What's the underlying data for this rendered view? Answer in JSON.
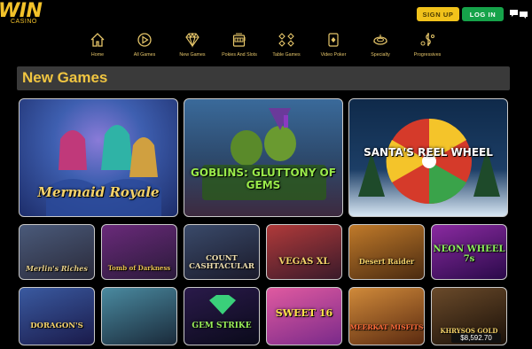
{
  "brand": {
    "name": "WIN",
    "sub": "CASINO"
  },
  "header": {
    "signup_label": "SIGN UP",
    "login_label": "LOG IN",
    "chat_icon": "chat-bubbles-icon"
  },
  "nav": [
    {
      "label": "Home",
      "icon": "home-icon"
    },
    {
      "label": "All Games",
      "icon": "play-circle-icon"
    },
    {
      "label": "New Games",
      "icon": "diamond-icon"
    },
    {
      "label": "Pokies And Slots",
      "icon": "slot-machine-icon"
    },
    {
      "label": "Table Games",
      "icon": "card-suits-icon"
    },
    {
      "label": "Video Poker",
      "icon": "playing-card-icon"
    },
    {
      "label": "Specialty",
      "icon": "roulette-icon"
    },
    {
      "label": "Progressives",
      "icon": "dollar-coins-icon"
    }
  ],
  "section": {
    "title": "New Games"
  },
  "games": [
    {
      "title": "Mermaid Royale"
    },
    {
      "title": "GOBLINS: GLUTTONY OF GEMS"
    },
    {
      "title": "SANTA'S REEL WHEEL"
    },
    {
      "title": "Merlin's Riches"
    },
    {
      "title": "Tomb of Darkness"
    },
    {
      "title": "COUNT CASHTACULAR"
    },
    {
      "title": "VEGAS XL"
    },
    {
      "title": "Desert Raider"
    },
    {
      "title": "NEON WHEEL 7s"
    },
    {
      "title": "DORAGON'S"
    },
    {
      "title": ""
    },
    {
      "title": "GEM STRIKE"
    },
    {
      "title": "SWEET 16"
    },
    {
      "title": "MEERKAT MISFITS"
    },
    {
      "title": "KHRYSOS GOLD",
      "jackpot": "$8,592.70"
    }
  ],
  "colors": {
    "accent": "#f0c541",
    "signup": "#f1c21b",
    "login": "#16a34a",
    "section_bg": "#3a3a3a"
  }
}
